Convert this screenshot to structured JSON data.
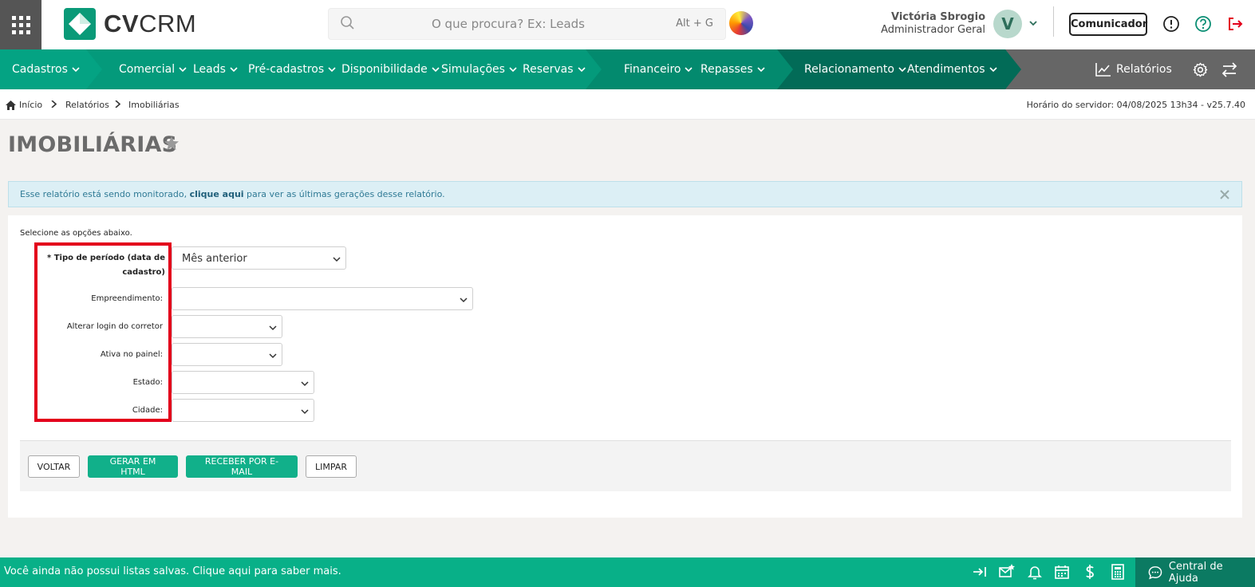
{
  "header": {
    "logo_bold": "CV",
    "logo_light": "CRM",
    "search_placeholder": "O que procura? Ex: Leads",
    "search_shortcut": "Alt + G",
    "user_name": "Victória Sbrogio",
    "user_role": "Administrador Geral",
    "avatar_initial": "V",
    "comunicador_label": "Comunicador",
    "icons": [
      "apps-grid-icon",
      "search-icon",
      "ai-assistant-icon",
      "chevron-down-icon",
      "info-icon",
      "help-icon",
      "logout-icon"
    ]
  },
  "nav": {
    "items": [
      {
        "label": "Cadastros"
      },
      {
        "label": "Comercial"
      },
      {
        "label": "Leads"
      },
      {
        "label": "Pré-cadastros"
      },
      {
        "label": "Disponibilidade"
      },
      {
        "label": "Simulações"
      },
      {
        "label": "Reservas"
      },
      {
        "label": "Financeiro"
      },
      {
        "label": "Repasses"
      },
      {
        "label": "Relacionamento"
      },
      {
        "label": "Atendimentos"
      }
    ],
    "reports_label": "Relatórios",
    "colors": {
      "segment_1": "#04a383",
      "segment_2": "#049a7b",
      "segment_3": "#038a6e",
      "segment_4": "#026b57",
      "right": "#666666"
    }
  },
  "breadcrumb": {
    "items": [
      "Início",
      "Relatórios",
      "Imobiliárias"
    ],
    "server_time": "Horário do servidor: 04/08/2025 13h34 - v25.7.40"
  },
  "page": {
    "title": "IMOBILIÁRIAS"
  },
  "alert": {
    "text_before": "Esse relatório está sendo monitorado, ",
    "link": "clique aqui",
    "text_after": " para ver as últimas gerações desse relatório."
  },
  "form": {
    "hint": "Selecione as opções abaixo.",
    "fields": [
      {
        "label": "* Tipo de período (data de cadastro)",
        "value": "Mês anterior"
      },
      {
        "label": "Empreendimento:",
        "value": ""
      },
      {
        "label": "Alterar login do corretor",
        "value": ""
      },
      {
        "label": "Ativa no painel:",
        "value": ""
      },
      {
        "label": "Estado:",
        "value": ""
      },
      {
        "label": "Cidade:",
        "value": ""
      }
    ],
    "buttons": {
      "back": "VOLTAR",
      "html": "GERAR EM HTML",
      "email": "RECEBER POR E-MAIL",
      "clear": "LIMPAR"
    },
    "highlight_color": "#e3001b"
  },
  "footer": {
    "text": "Você ainda não possui listas salvas. Clique aqui para saber mais.",
    "help_center": "Central de Ajuda",
    "accent": "#08b088"
  }
}
